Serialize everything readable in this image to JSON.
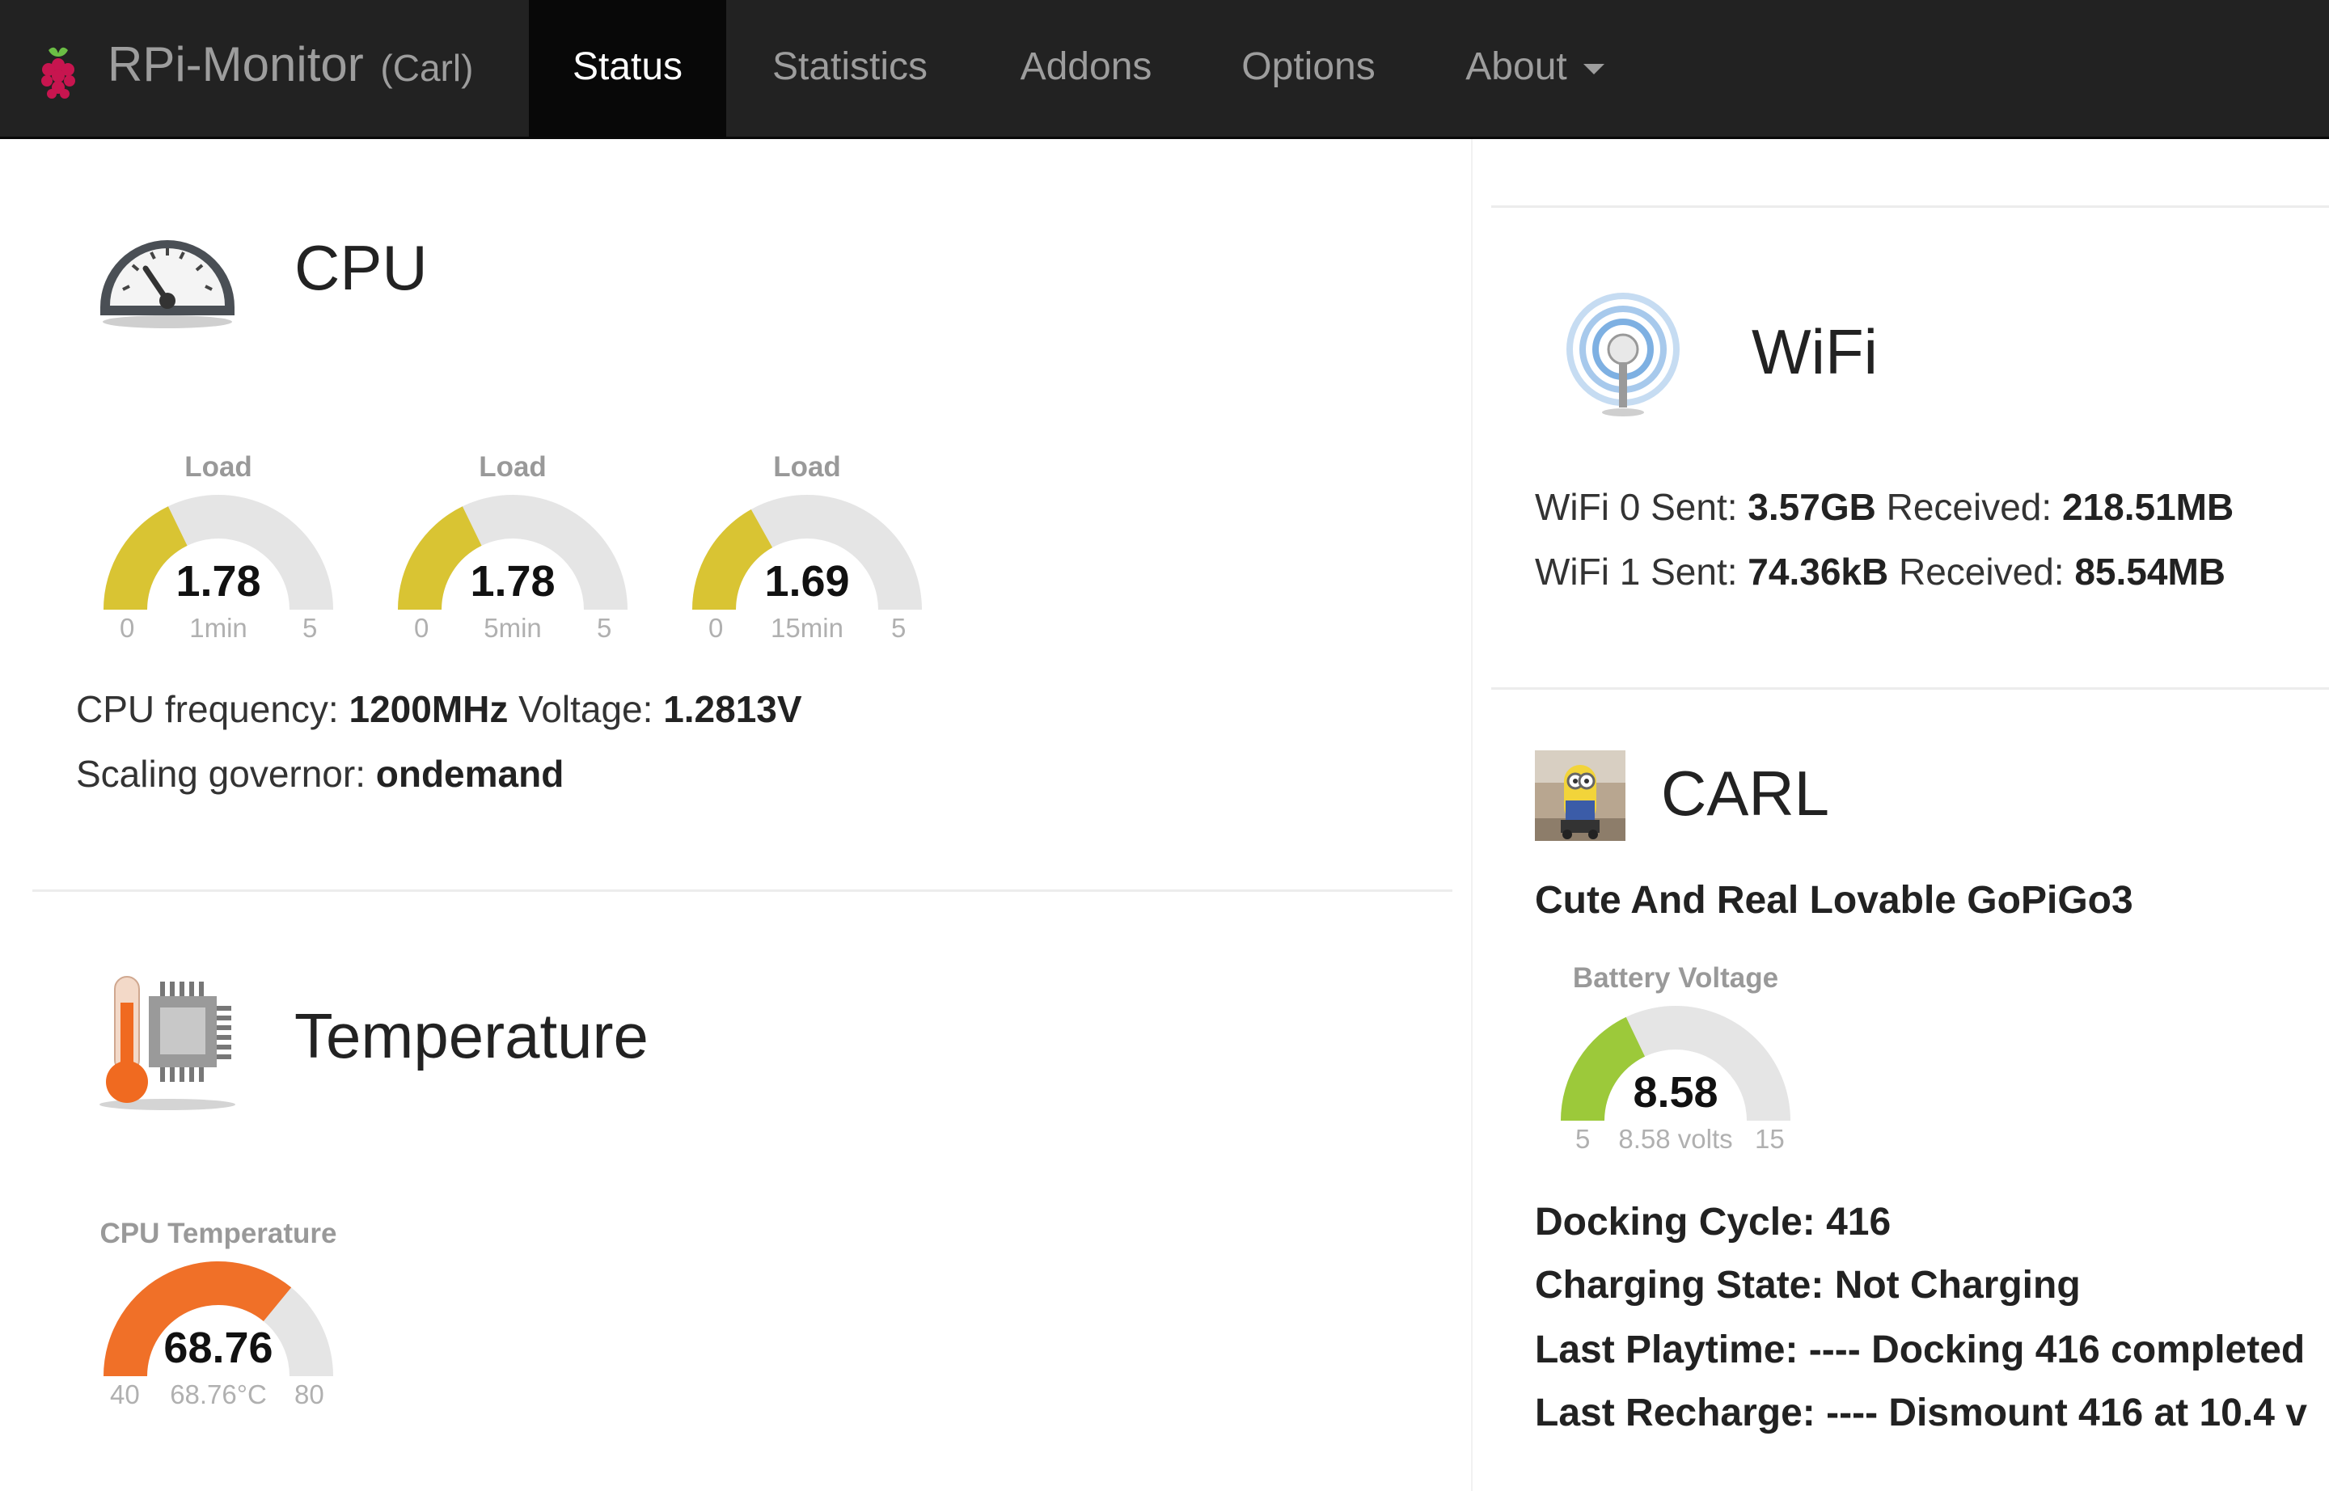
{
  "nav": {
    "brand": "RPi-Monitor",
    "brand_sub": "(Carl)",
    "items": [
      {
        "label": "Status",
        "active": true
      },
      {
        "label": "Statistics"
      },
      {
        "label": "Addons"
      },
      {
        "label": "Options"
      },
      {
        "label": "About",
        "dropdown": true
      }
    ]
  },
  "cpu": {
    "title": "CPU",
    "icon": "gauge-icon",
    "gauges": [
      {
        "title": "Load",
        "value": "1.78",
        "label": "1min",
        "min": "0",
        "max": "5",
        "fraction": 0.356,
        "color": "#d9c433"
      },
      {
        "title": "Load",
        "value": "1.78",
        "label": "5min",
        "min": "0",
        "max": "5",
        "fraction": 0.356,
        "color": "#d9c433"
      },
      {
        "title": "Load",
        "value": "1.69",
        "label": "15min",
        "min": "0",
        "max": "5",
        "fraction": 0.338,
        "color": "#d9c433"
      }
    ],
    "freq_label": "CPU frequency:",
    "freq_value": "1200MHz",
    "voltage_label": "Voltage:",
    "voltage_value": "1.2813V",
    "governor_label": "Scaling governor:",
    "governor_value": "ondemand"
  },
  "temperature": {
    "title": "Temperature",
    "icon": "thermometer-chip-icon",
    "gauge": {
      "title": "CPU Temperature",
      "value": "68.76",
      "label": "68.76°C",
      "min": "40",
      "max": "80",
      "fraction": 0.719,
      "color": "#f07028"
    }
  },
  "wifi": {
    "title": "WiFi",
    "icon": "wifi-antenna-icon",
    "rows": [
      {
        "prefix": "WiFi 0 Sent:",
        "sent": "3.57GB",
        "recv_label": "Received:",
        "received": "218.51MB"
      },
      {
        "prefix": "WiFi 1 Sent:",
        "sent": "74.36kB",
        "recv_label": "Received:",
        "received": "85.54MB"
      }
    ]
  },
  "carl": {
    "title": "CARL",
    "icon": "robot-photo-icon",
    "subtitle": "Cute And Real Lovable GoPiGo3",
    "gauge": {
      "title": "Battery Voltage",
      "value": "8.58",
      "label": "8.58 volts",
      "min": "5",
      "max": "15",
      "fraction": 0.358,
      "color": "#9cc93a"
    },
    "lines": [
      "Docking Cycle: 416",
      "Charging State: Not Charging",
      "Last Playtime: ---- Docking 416 completed",
      "Last Recharge: ---- Dismount 416 at 10.4 v"
    ]
  }
}
